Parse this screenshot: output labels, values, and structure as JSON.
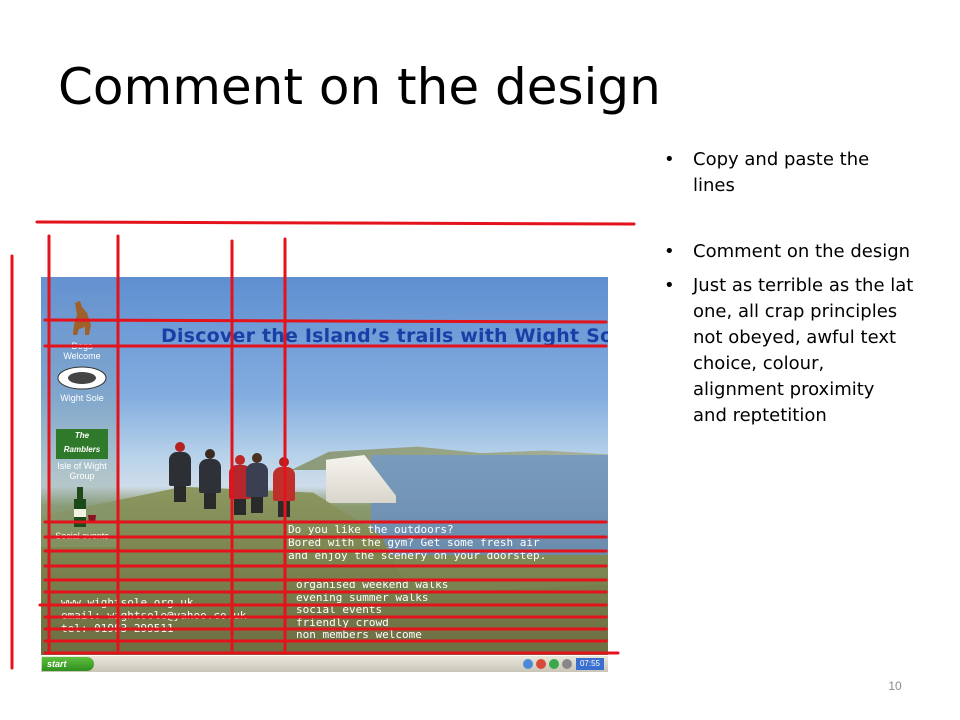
{
  "slide": {
    "title": "Comment on the design",
    "bullets": [
      "Copy and paste the lines",
      "Comment on the design",
      "Just as terrible as the lat one, all crap principles not obeyed, awful text choice, colour, alignment proximity and reptetition"
    ],
    "page_number": "10"
  },
  "screenshot": {
    "banner": "Discover the Island’s trails with Wight Sole",
    "left_logos": [
      "Dogs Welcome",
      "Wight Sole",
      "Isle of Wight Group",
      "Social events"
    ],
    "ramblers_logo_text": "The Ramblers",
    "pitch_lines": [
      "Do you like the outdoors?",
      "Bored with the gym? Get some fresh air",
      "and enjoy the scenery on your doorstep."
    ],
    "features": [
      "organised weekend walks",
      "evening summer walks",
      "social events",
      "friendly crowd",
      "non members welcome"
    ],
    "contact": {
      "website": "www.wightsole.org.uk",
      "email": "email: wightsole@yahoo.co.uk",
      "tel": "tel: 01983 299511"
    },
    "taskbar": {
      "start_label": "start",
      "clock": "07:55"
    }
  },
  "colors": {
    "grid_lines": "#e3121b",
    "banner_text": "#1a3fa6"
  }
}
